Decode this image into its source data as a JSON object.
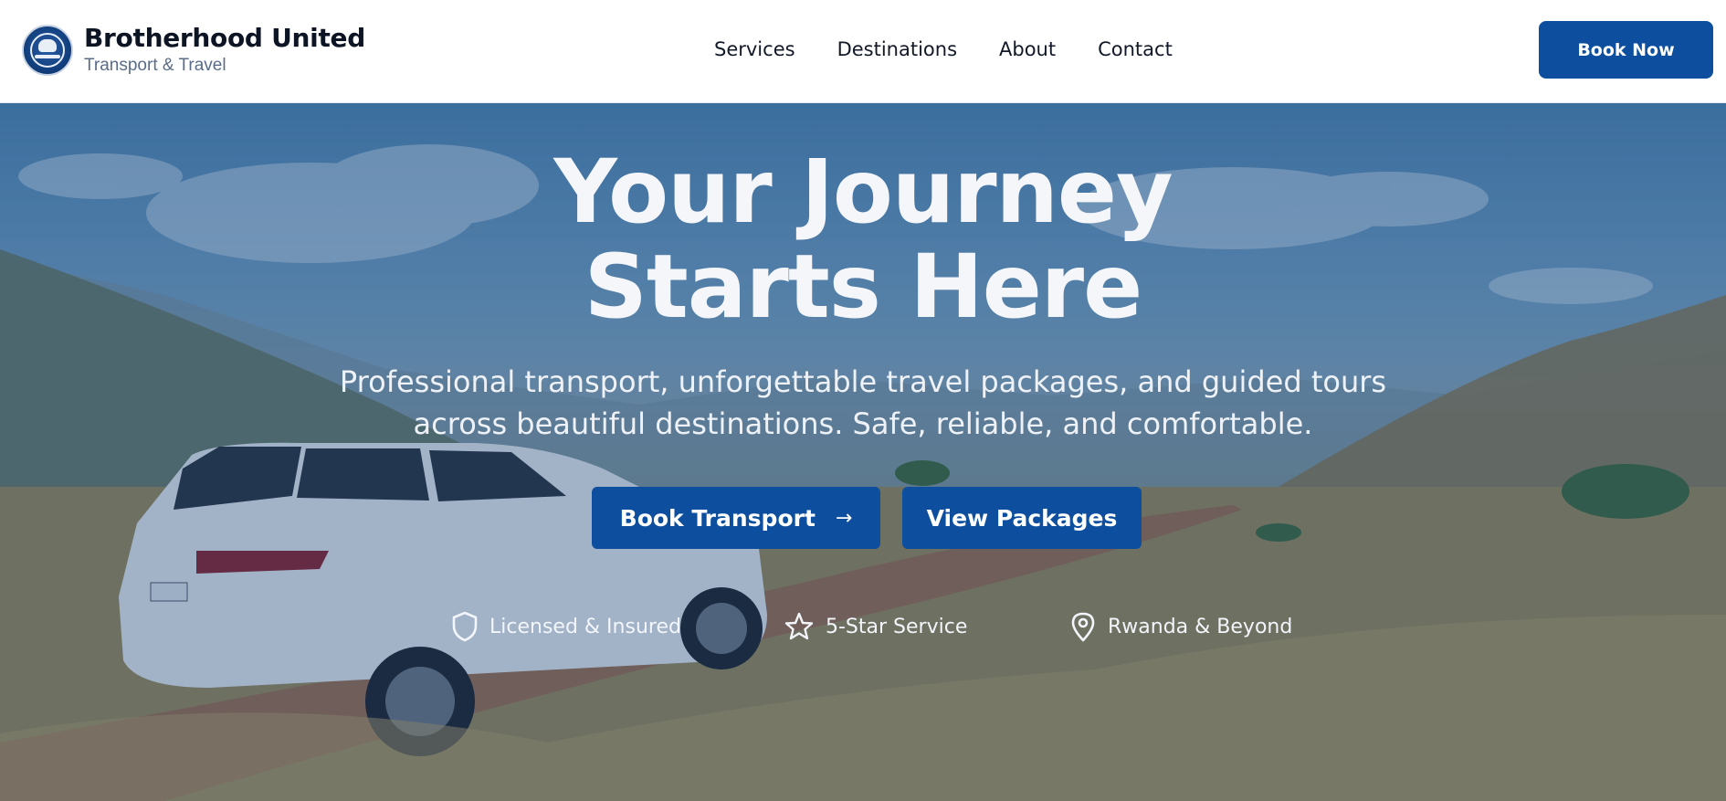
{
  "brand": {
    "name": "Brotherhood United",
    "tagline": "Transport & Travel",
    "logo_icon": "company-emblem-icon"
  },
  "nav": {
    "items": [
      {
        "label": "Services"
      },
      {
        "label": "Destinations"
      },
      {
        "label": "About"
      },
      {
        "label": "Contact"
      }
    ],
    "cta_label": "Book Now"
  },
  "hero": {
    "headline_line1": "Your Journey",
    "headline_line2": "Starts Here",
    "subtitle": "Professional transport, unforgettable travel packages, and guided tours across beautiful destinations. Safe, reliable, and comfortable.",
    "primary_button": {
      "label": "Book Transport",
      "icon": "arrow-right-icon"
    },
    "secondary_button": {
      "label": "View Packages"
    },
    "background_image": "white SUV driving on a dirt road through grassy mountain valley"
  },
  "badges": [
    {
      "label": "Licensed & Insured",
      "icon": "shield-icon"
    },
    {
      "label": "5-Star Service",
      "icon": "star-icon"
    },
    {
      "label": "Rwanda & Beyond",
      "icon": "map-pin-icon"
    }
  ],
  "colors": {
    "primary": "#0d4f9e",
    "header_bg": "#ffffff",
    "heading_text": "#0d1424",
    "muted_text": "#5a6c88",
    "hero_text": "#f4f6f9"
  }
}
